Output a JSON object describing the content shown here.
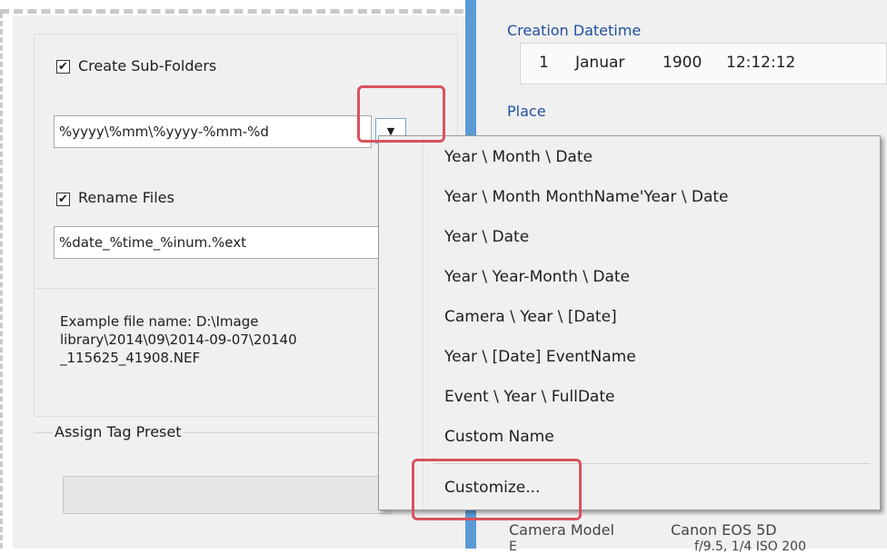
{
  "left_panel": {
    "create_subfolders": {
      "label": "Create Sub-Folders",
      "checked": "✔"
    },
    "subfolder_pattern": "%yyyy\\%mm\\%yyyy-%mm-%d",
    "rename_files": {
      "label": "Rename Files",
      "checked": "✔"
    },
    "rename_pattern": "%date_%time_%inum.%ext",
    "example": {
      "line1": "Example file name: D:\\Image",
      "line2": "library\\2014\\09\\2014-09-07\\20140",
      "line3": "_115625_41908.NEF"
    },
    "assign_tag_preset_label": "Assign Tag Preset"
  },
  "right_panel": {
    "creation_datetime_label": "Creation Datetime",
    "datetime": {
      "day": "1",
      "month": "Januar",
      "year": "1900",
      "time": "12:12:12"
    },
    "place_label": "Place",
    "camera_model_label": "Camera Model",
    "camera_model_value": "Canon EOS 5D",
    "exposure_label": "E",
    "exposure_value": "f/9.5, 1/4     ISO 200"
  },
  "dropdown_menu": {
    "items": [
      "Year \\ Month \\ Date",
      "Year \\ Month MonthName'Year \\ Date",
      "Year \\ Date",
      "Year \\ Year-Month \\ Date",
      "Camera \\ Year \\ [Date]",
      "Year \\ [Date] EventName",
      "Event \\ Year \\ FullDate",
      "Custom Name"
    ],
    "customize": "Customize..."
  },
  "colors": {
    "highlight": "#d9525e",
    "section_title": "#1f4f9e",
    "splitter": "#5a9bd5"
  },
  "icons": {
    "dropdown_arrow": "chevron-down-icon",
    "checkmark": "check-icon"
  }
}
